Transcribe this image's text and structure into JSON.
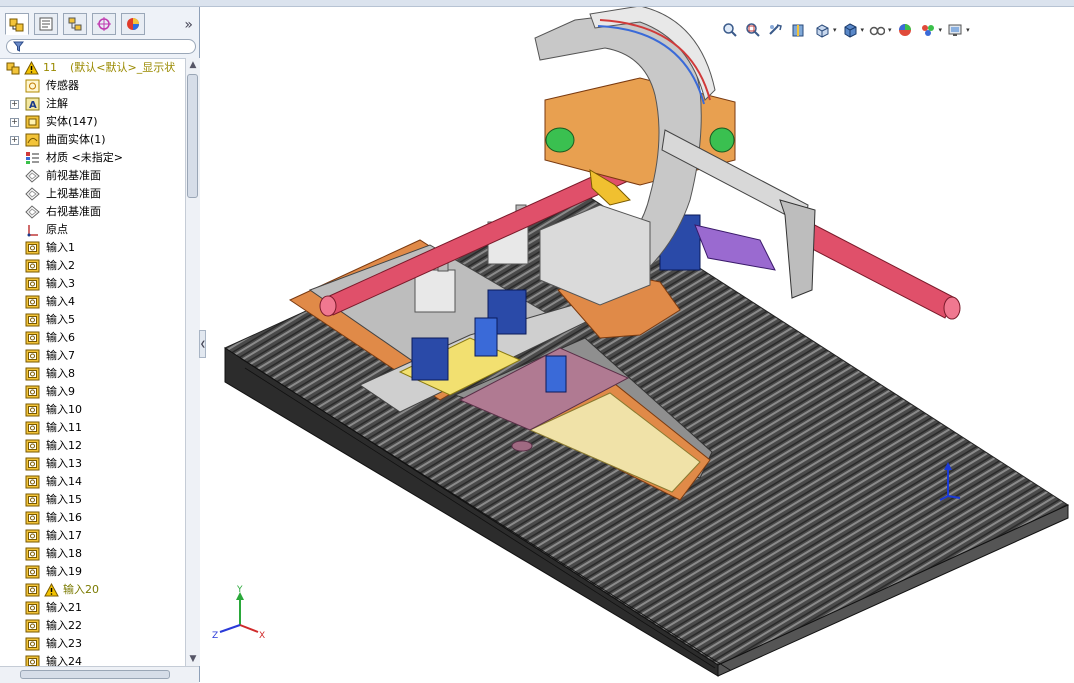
{
  "tree": {
    "root": {
      "count": "11",
      "label": "(默认<默认>_显示状"
    },
    "items": [
      {
        "label": "传感器",
        "icon": "sensor-icon",
        "expand": false
      },
      {
        "label": "注解",
        "icon": "annotation-icon",
        "expand": true
      },
      {
        "label": "实体(147)",
        "icon": "solid-body-icon",
        "expand": true
      },
      {
        "label": "曲面实体(1)",
        "icon": "surface-body-icon",
        "expand": true
      },
      {
        "label": "材质 <未指定>",
        "icon": "material-icon",
        "expand": false
      },
      {
        "label": "前视基准面",
        "icon": "plane-icon",
        "expand": false
      },
      {
        "label": "上视基准面",
        "icon": "plane-icon",
        "expand": false
      },
      {
        "label": "右视基准面",
        "icon": "plane-icon",
        "expand": false
      },
      {
        "label": "原点",
        "icon": "origin-icon",
        "expand": false
      },
      {
        "label": "输入1",
        "icon": "feature-icon",
        "expand": false
      },
      {
        "label": "输入2",
        "icon": "feature-icon",
        "expand": false
      },
      {
        "label": "输入3",
        "icon": "feature-icon",
        "expand": false
      },
      {
        "label": "输入4",
        "icon": "feature-icon",
        "expand": false
      },
      {
        "label": "输入5",
        "icon": "feature-icon",
        "expand": false
      },
      {
        "label": "输入6",
        "icon": "feature-icon",
        "expand": false
      },
      {
        "label": "输入7",
        "icon": "feature-icon",
        "expand": false
      },
      {
        "label": "输入8",
        "icon": "feature-icon",
        "expand": false
      },
      {
        "label": "输入9",
        "icon": "feature-icon",
        "expand": false
      },
      {
        "label": "输入10",
        "icon": "feature-icon",
        "expand": false
      },
      {
        "label": "输入11",
        "icon": "feature-icon",
        "expand": false
      },
      {
        "label": "输入12",
        "icon": "feature-icon",
        "expand": false
      },
      {
        "label": "输入13",
        "icon": "feature-icon",
        "expand": false
      },
      {
        "label": "输入14",
        "icon": "feature-icon",
        "expand": false
      },
      {
        "label": "输入15",
        "icon": "feature-icon",
        "expand": false
      },
      {
        "label": "输入16",
        "icon": "feature-icon",
        "expand": false
      },
      {
        "label": "输入17",
        "icon": "feature-icon",
        "expand": false
      },
      {
        "label": "输入18",
        "icon": "feature-icon",
        "expand": false
      },
      {
        "label": "输入19",
        "icon": "feature-icon",
        "expand": false
      },
      {
        "label": "输入20",
        "icon": "feature-icon",
        "expand": false,
        "warning": true
      },
      {
        "label": "输入21",
        "icon": "feature-icon",
        "expand": false
      },
      {
        "label": "输入22",
        "icon": "feature-icon",
        "expand": false
      },
      {
        "label": "输入23",
        "icon": "feature-icon",
        "expand": false
      },
      {
        "label": "输入24",
        "icon": "feature-icon",
        "expand": false
      }
    ]
  },
  "tabs": [
    "feature-manager-tab",
    "property-manager-tab",
    "configuration-manager-tab",
    "dimxpert-tab",
    "display-manager-tab"
  ],
  "view_toolbar": [
    "zoom-to-fit-icon",
    "zoom-to-area-icon",
    "previous-view-icon",
    "section-view-icon",
    "view-orientation-icon",
    "display-style-icon",
    "hide-show-items-icon",
    "edit-appearance-icon",
    "apply-scene-icon",
    "view-settings-icon"
  ],
  "triad": {
    "x": "X",
    "y": "Y",
    "z": "Z"
  },
  "colors": {
    "panel_bg": "#eef2f8",
    "warning": "#f2c200",
    "rail": "#3f3f3f",
    "accent_orange": "#e88a3a",
    "pipe": "#e05070"
  }
}
